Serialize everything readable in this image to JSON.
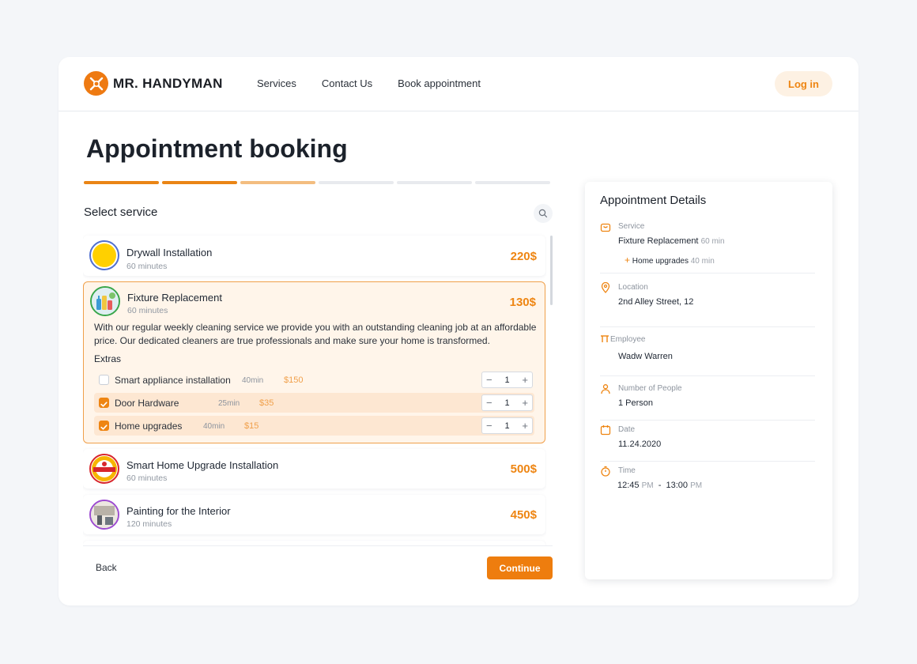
{
  "brand": {
    "name": "MR. HANDYMAN",
    "accent": "#ee7a12"
  },
  "nav": {
    "items": [
      "Services",
      "Contact Us",
      "Book appointment"
    ],
    "login_label": "Log in"
  },
  "page": {
    "title": "Appointment booking",
    "steps_total": 6,
    "steps_done": 2,
    "step_in_progress": 3
  },
  "service_select": {
    "label": "Select service"
  },
  "services": [
    {
      "name": "Drywall Installation",
      "duration": "60 minutes",
      "price": "220$",
      "icon": "yellow-circle-thumb"
    },
    {
      "name": "Fixture Replacement",
      "duration": "60 minutes",
      "price": "130$",
      "icon": "cleaning-supplies-thumb",
      "selected": true,
      "description": "With our regular weekly cleaning service we provide you with an outstanding cleaning job at an affordable price. Our dedicated cleaners are true professionals and make sure your home is transformed.",
      "extras_title": "Extras",
      "extras": [
        {
          "name": "Smart appliance installation",
          "minutes": "40min",
          "price": "$150",
          "checked": false,
          "qty": "1"
        },
        {
          "name": "Door Hardware",
          "minutes": "25min",
          "price": "$35",
          "checked": true,
          "qty": "1"
        },
        {
          "name": "Home upgrades",
          "minutes": "40min",
          "price": "$15",
          "checked": true,
          "qty": "1"
        }
      ]
    },
    {
      "name": "Smart Home Upgrade Installation",
      "duration": "60 minutes",
      "price": "500$",
      "icon": "handyman-badge-thumb"
    },
    {
      "name": "Painting for the Interior",
      "duration": "120 minutes",
      "price": "450$",
      "icon": "interior-photo-thumb"
    }
  ],
  "actions": {
    "back": "Back",
    "continue": "Continue"
  },
  "details": {
    "title": "Appointment Details",
    "service": {
      "label": "Service",
      "name": "Fixture Replacement",
      "duration": "60 min",
      "extra_name": "Home upgrades",
      "extra_duration": "40 min"
    },
    "location": {
      "label": "Location",
      "value": "2nd Alley Street, 12"
    },
    "employee": {
      "label": "Employee",
      "value": "Wadw Warren"
    },
    "people": {
      "label": "Number of People",
      "value": "1 Person"
    },
    "date": {
      "label": "Date",
      "value": "11.24.2020"
    },
    "time": {
      "label": "Time",
      "start": "12:45",
      "start_suffix": "PM",
      "separator": "-",
      "end": "13:00",
      "end_suffix": "PM"
    }
  }
}
